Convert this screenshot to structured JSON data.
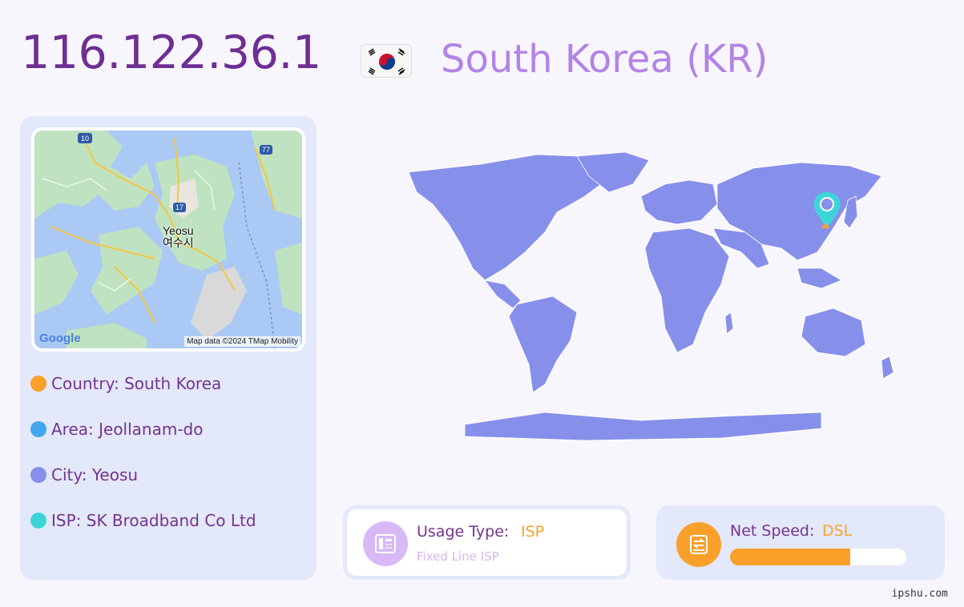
{
  "header": {
    "ip": "116.122.36.1",
    "country_display": "South Korea (KR)",
    "flag_icon": "south-korea-flag-icon"
  },
  "map": {
    "city_en": "Yeosu",
    "city_ko": "여수시",
    "attribution": "Map data ©2024 TMap Mobility",
    "provider": "Google",
    "road_markers": [
      "10",
      "77",
      "17"
    ]
  },
  "info": [
    {
      "text": "Country: South Korea",
      "color": "#f8a02a"
    },
    {
      "text": "Area: Jeollanam-do",
      "color": "#42a7ef"
    },
    {
      "text": "City: Yeosu",
      "color": "#8690ea"
    },
    {
      "text": "ISP: SK Broadband Co Ltd",
      "color": "#3dd6d8"
    }
  ],
  "usage": {
    "label": "Usage Type:",
    "value": "ISP",
    "sub": "Fixed Line ISP",
    "icon": "fax-phone-icon"
  },
  "speed": {
    "label": "Net Speed:",
    "value": "DSL",
    "icon": "network-drive-icon",
    "level": 0.68
  },
  "footer": "ipshu.com",
  "colors": {
    "accent_purple": "#6e2f94",
    "country_purple": "#b383e6",
    "map_land": "#8690ea",
    "marker": "#3dd6d8",
    "orange": "#f8a02a"
  }
}
